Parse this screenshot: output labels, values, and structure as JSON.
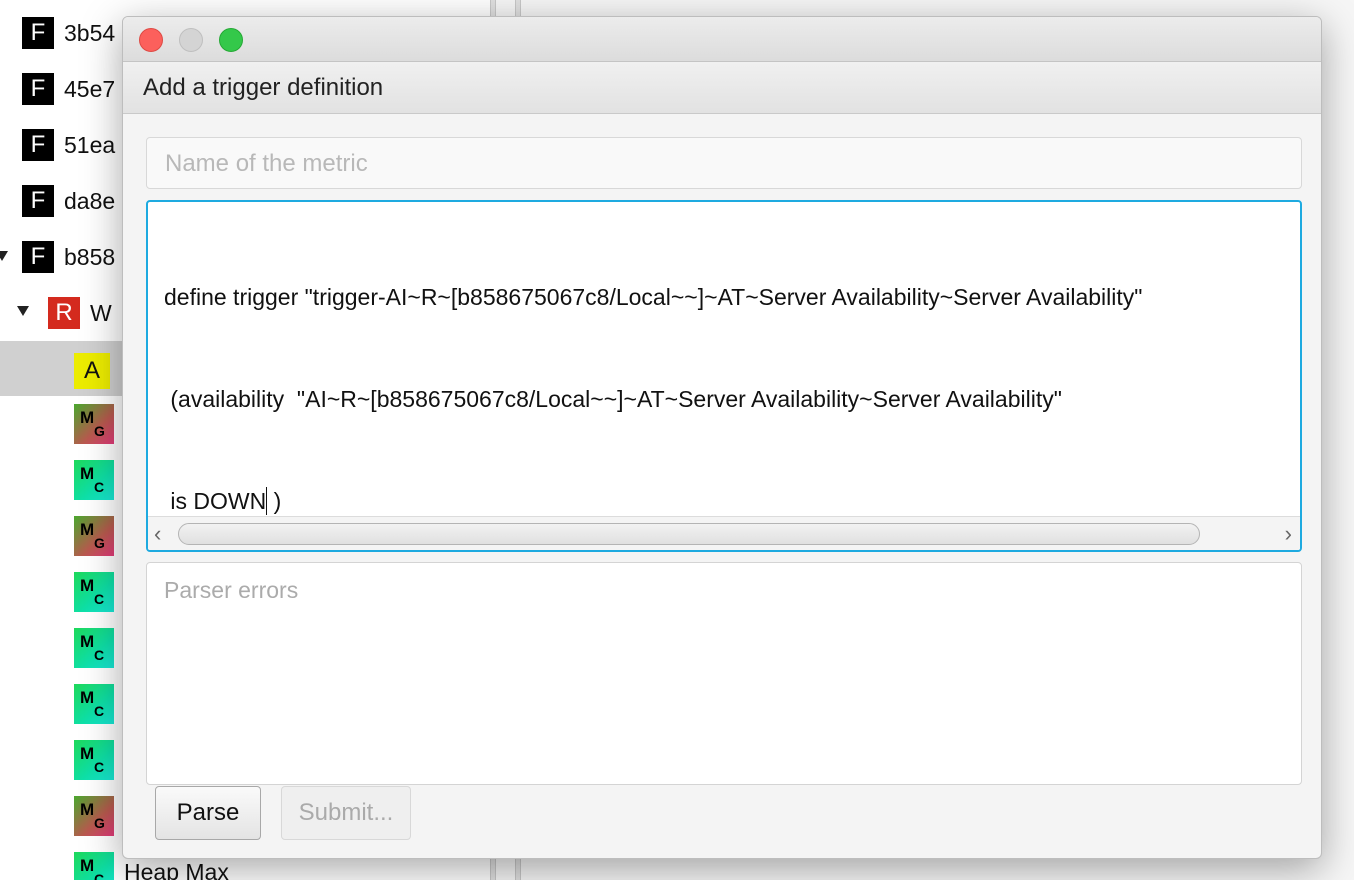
{
  "tree": {
    "items": [
      {
        "badge": "F",
        "label": "3b54"
      },
      {
        "badge": "F",
        "label": "45e7"
      },
      {
        "badge": "F",
        "label": "51ea"
      },
      {
        "badge": "F",
        "label": "da8e"
      },
      {
        "badge": "F",
        "label": "b858"
      },
      {
        "badge": "R",
        "label": "W"
      },
      {
        "badge": "A",
        "label": ""
      },
      {
        "badge_main": "M",
        "badge_sub": "G"
      },
      {
        "badge_main": "M",
        "badge_sub": "C"
      },
      {
        "badge_main": "M",
        "badge_sub": "G"
      },
      {
        "badge_main": "M",
        "badge_sub": "C"
      },
      {
        "badge_main": "M",
        "badge_sub": "C"
      },
      {
        "badge_main": "M",
        "badge_sub": "C"
      },
      {
        "badge_main": "M",
        "badge_sub": "C"
      },
      {
        "badge_main": "M",
        "badge_sub": "G"
      },
      {
        "badge_main": "M",
        "badge_sub": "C",
        "label": "Heap Max"
      }
    ]
  },
  "dialog": {
    "header": "Add a trigger definition",
    "metric_placeholder": "Name of the metric",
    "code_lines": [
      "define trigger \"trigger-AI~R~[b858675067c8/Local~~]~AT~Server Availability~Server Availability\"",
      " (availability  \"AI~R~[b858675067c8/Local~~]~AT~Server Availability~Server Availability\"",
      " is DOWN",
      " )"
    ],
    "errors_placeholder": "Parser errors",
    "parse_label": "Parse",
    "submit_label": "Submit..."
  },
  "colors": {
    "focus_ring": "#1eaae0",
    "close": "#fc605c",
    "maximize": "#34c84a",
    "badge_f": "#000000",
    "badge_r": "#d42a1e",
    "badge_a": "#ecec00"
  }
}
